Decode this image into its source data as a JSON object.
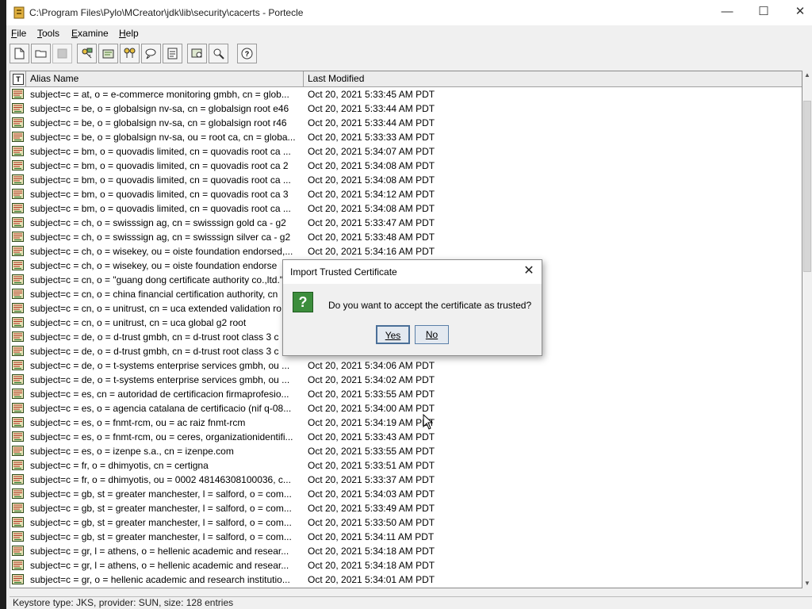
{
  "window": {
    "title": "C:\\Program Files\\Pylo\\MCreator\\jdk\\lib\\security\\cacerts - Portecle",
    "minimize_icon": "minimize-icon",
    "maximize_icon": "maximize-icon",
    "close_icon": "close-icon"
  },
  "menu": [
    "File",
    "Tools",
    "Examine",
    "Help"
  ],
  "toolbar": {
    "buttons": [
      "new-keystore-icon",
      "open-keystore-icon",
      "save-keystore-icon",
      "generate-keypair-icon",
      "import-trusted-cert-icon",
      "import-keypair-icon",
      "set-password-icon",
      "keystore-report-icon",
      "examine-certificate-icon",
      "examine-crl-icon",
      "help-icon"
    ]
  },
  "table": {
    "columns": {
      "type": "T",
      "alias": "Alias Name",
      "modified": "Last Modified"
    },
    "rows": [
      {
        "alias": "subject=c = at, o = e-commerce monitoring gmbh, cn = glob...",
        "modified": "Oct 20, 2021 5:33:45 AM PDT"
      },
      {
        "alias": "subject=c = be, o = globalsign nv-sa, cn = globalsign root e46",
        "modified": "Oct 20, 2021 5:33:44 AM PDT"
      },
      {
        "alias": "subject=c = be, o = globalsign nv-sa, cn = globalsign root r46",
        "modified": "Oct 20, 2021 5:33:44 AM PDT"
      },
      {
        "alias": "subject=c = be, o = globalsign nv-sa, ou = root ca, cn = globa...",
        "modified": "Oct 20, 2021 5:33:33 AM PDT"
      },
      {
        "alias": "subject=c = bm, o = quovadis limited, cn = quovadis root ca ...",
        "modified": "Oct 20, 2021 5:34:07 AM PDT"
      },
      {
        "alias": "subject=c = bm, o = quovadis limited, cn = quovadis root ca 2",
        "modified": "Oct 20, 2021 5:34:08 AM PDT"
      },
      {
        "alias": "subject=c = bm, o = quovadis limited, cn = quovadis root ca ...",
        "modified": "Oct 20, 2021 5:34:08 AM PDT"
      },
      {
        "alias": "subject=c = bm, o = quovadis limited, cn = quovadis root ca 3",
        "modified": "Oct 20, 2021 5:34:12 AM PDT"
      },
      {
        "alias": "subject=c = bm, o = quovadis limited, cn = quovadis root ca ...",
        "modified": "Oct 20, 2021 5:34:08 AM PDT"
      },
      {
        "alias": "subject=c = ch, o = swisssign ag, cn = swisssign gold ca - g2",
        "modified": "Oct 20, 2021 5:33:47 AM PDT"
      },
      {
        "alias": "subject=c = ch, o = swisssign ag, cn = swisssign silver ca - g2",
        "modified": "Oct 20, 2021 5:33:48 AM PDT"
      },
      {
        "alias": "subject=c = ch, o = wisekey, ou = oiste foundation endorsed,...",
        "modified": "Oct 20, 2021 5:34:16 AM PDT"
      },
      {
        "alias": "subject=c = ch, o = wisekey, ou = oiste foundation endorse",
        "modified": ""
      },
      {
        "alias": "subject=c = cn, o = \"guang dong certificate authority co.,ltd.\"",
        "modified": ""
      },
      {
        "alias": "subject=c = cn, o = china financial certification authority, cn",
        "modified": ""
      },
      {
        "alias": "subject=c = cn, o = unitrust, cn = uca extended validation ro",
        "modified": ""
      },
      {
        "alias": "subject=c = cn, o = unitrust, cn = uca global g2 root",
        "modified": ""
      },
      {
        "alias": "subject=c = de, o = d-trust gmbh, cn = d-trust root class 3 c",
        "modified": ""
      },
      {
        "alias": "subject=c = de, o = d-trust gmbh, cn = d-trust root class 3 c",
        "modified": ""
      },
      {
        "alias": "subject=c = de, o = t-systems enterprise services gmbh, ou ...",
        "modified": "Oct 20, 2021 5:34:06 AM PDT"
      },
      {
        "alias": "subject=c = de, o = t-systems enterprise services gmbh, ou ...",
        "modified": "Oct 20, 2021 5:34:02 AM PDT"
      },
      {
        "alias": "subject=c = es, cn = autoridad de certificacion firmaprofesio...",
        "modified": "Oct 20, 2021 5:33:55 AM PDT"
      },
      {
        "alias": "subject=c = es, o = agencia catalana de certificacio (nif q-08...",
        "modified": "Oct 20, 2021 5:34:00 AM PDT"
      },
      {
        "alias": "subject=c = es, o = fnmt-rcm, ou = ac raiz fnmt-rcm",
        "modified": "Oct 20, 2021 5:34:19 AM PDT"
      },
      {
        "alias": "subject=c = es, o = fnmt-rcm, ou = ceres, organizationidentifi...",
        "modified": "Oct 20, 2021 5:33:43 AM PDT"
      },
      {
        "alias": "subject=c = es, o = izenpe s.a., cn = izenpe.com",
        "modified": "Oct 20, 2021 5:33:55 AM PDT"
      },
      {
        "alias": "subject=c = fr, o = dhimyotis, cn = certigna",
        "modified": "Oct 20, 2021 5:33:51 AM PDT"
      },
      {
        "alias": "subject=c = fr, o = dhimyotis, ou = 0002 48146308100036, c...",
        "modified": "Oct 20, 2021 5:33:37 AM PDT"
      },
      {
        "alias": "subject=c = gb, st = greater manchester, l = salford, o = com...",
        "modified": "Oct 20, 2021 5:34:03 AM PDT"
      },
      {
        "alias": "subject=c = gb, st = greater manchester, l = salford, o = com...",
        "modified": "Oct 20, 2021 5:33:49 AM PDT"
      },
      {
        "alias": "subject=c = gb, st = greater manchester, l = salford, o = com...",
        "modified": "Oct 20, 2021 5:33:50 AM PDT"
      },
      {
        "alias": "subject=c = gb, st = greater manchester, l = salford, o = com...",
        "modified": "Oct 20, 2021 5:34:11 AM PDT"
      },
      {
        "alias": "subject=c = gr, l = athens, o = hellenic academic and resear...",
        "modified": "Oct 20, 2021 5:34:18 AM PDT"
      },
      {
        "alias": "subject=c = gr, l = athens, o = hellenic academic and resear...",
        "modified": "Oct 20, 2021 5:34:18 AM PDT"
      },
      {
        "alias": "subject=c = gr, o = hellenic academic and research institutio...",
        "modified": "Oct 20, 2021 5:34:01 AM PDT"
      }
    ]
  },
  "status": "Keystore type: JKS, provider: SUN, size: 128 entries",
  "dialog": {
    "title": "Import Trusted Certificate",
    "message": "Do you want to accept the certificate as trusted?",
    "yes_label": "Yes",
    "no_label": "No",
    "icon": "question-icon"
  },
  "colors": {
    "accent": "#3c8d3c",
    "button_border": "#5a7fa8"
  }
}
